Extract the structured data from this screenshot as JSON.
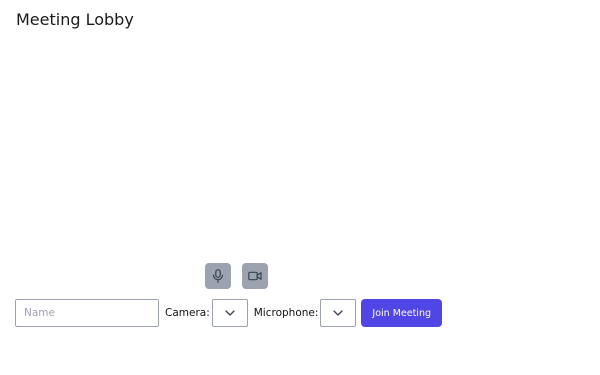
{
  "header": {
    "title": "Meeting Lobby"
  },
  "media_toggles": {
    "microphone_icon": "microphone-icon",
    "camera_icon": "video-camera-icon",
    "toggle_color": "#9ca3af"
  },
  "form": {
    "name_value": "",
    "name_placeholder": "Name",
    "camera_label": "Camera:",
    "camera_selected": "",
    "microphone_label": "Microphone:",
    "microphone_selected": "",
    "join_label": "Join Meeting",
    "join_color": "#4f46e5"
  }
}
